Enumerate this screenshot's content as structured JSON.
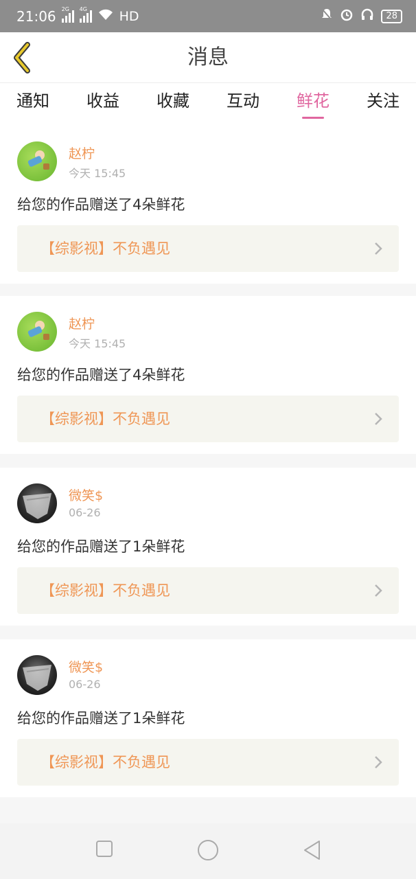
{
  "status_bar": {
    "time": "21:06",
    "network1": "2G",
    "network2": "4G",
    "hd": "HD",
    "battery": "28"
  },
  "header": {
    "title": "消息",
    "back_icon": "chevron-left-icon"
  },
  "tabs": [
    {
      "label": "通知",
      "active": false
    },
    {
      "label": "收益",
      "active": false
    },
    {
      "label": "收藏",
      "active": false
    },
    {
      "label": "互动",
      "active": false
    },
    {
      "label": "鲜花",
      "active": true
    },
    {
      "label": "关注",
      "active": false
    }
  ],
  "messages": [
    {
      "user": "赵柠",
      "time": "今天 15:45",
      "text": "给您的作品赠送了4朵鲜花",
      "work": "【综影视】不负遇见"
    },
    {
      "user": "赵柠",
      "time": "今天 15:45",
      "text": "给您的作品赠送了4朵鲜花",
      "work": "【综影视】不负遇见"
    },
    {
      "user": "微笑$",
      "time": "06-26",
      "text": "给您的作品赠送了1朵鲜花",
      "work": "【综影视】不负遇见"
    },
    {
      "user": "微笑$",
      "time": "06-26",
      "text": "给您的作品赠送了1朵鲜花",
      "work": "【综影视】不负遇见"
    }
  ],
  "colors": {
    "accent_pink": "#e0669f",
    "name_orange": "#ef9655",
    "status_bar": "#8d8d8d",
    "back_arrow": "#e8c92c"
  }
}
